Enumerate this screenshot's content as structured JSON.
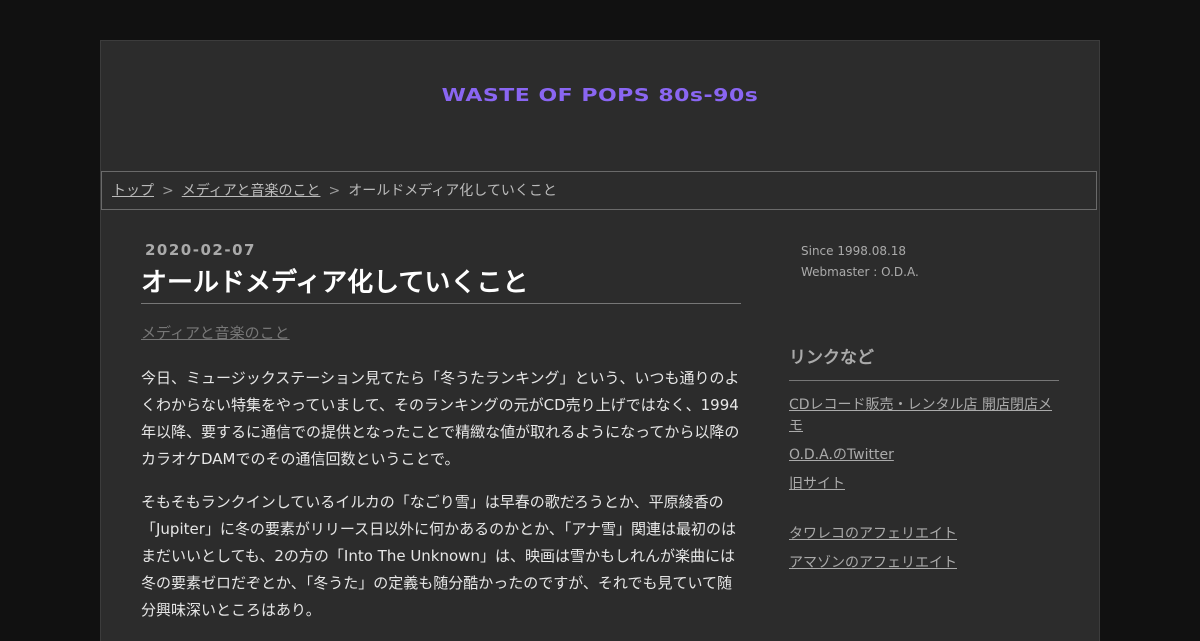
{
  "header": {
    "site_title": "WASTE OF POPS 80s-90s"
  },
  "breadcrumb": {
    "items": [
      "トップ",
      "メディアと音楽のこと"
    ],
    "separator": ">",
    "current": "オールドメディア化していくこと"
  },
  "article": {
    "date": "2020-02-07",
    "title": "オールドメディア化していくこと",
    "category": "メディアと音楽のこと",
    "paragraphs": [
      "今日、ミュージックステーション見てたら「冬うたランキング」という、いつも通りのよくわからない特集をやっていまして、そのランキングの元がCD売り上げではなく、1994年以降、要するに通信での提供となったことで精緻な値が取れるようになってから以降のカラオケDAMでのその通信回数ということで。",
      "そもそもランクインしているイルカの「なごり雪」は早春の歌だろうとか、平原綾香の「Jupiter」に冬の要素がリリース日以外に何かあるのかとか、「アナ雪」関連は最初のはまだいいとしても、2の方の「Into The Unknown」は、映画は雪かもしれんが楽曲には冬の要素ゼロだぞとか、「冬うた」の定義も随分酷かったのですが、それでも見ていて随分興味深いところはあり。"
    ]
  },
  "sidebar": {
    "since": "Since 1998.08.18",
    "webmaster": "Webmaster : O.D.A.",
    "links_heading": "リンクなど",
    "links": [
      "CDレコード販売・レンタル店 開店閉店メモ",
      "O.D.A.のTwitter",
      "旧サイト"
    ],
    "affiliates": [
      "タワレコのアフェリエイト",
      "アマゾンのアフェリエイト"
    ]
  },
  "colors": {
    "accent": "#8a66f2",
    "background": "#111111",
    "panel": "#2c2c2c"
  }
}
